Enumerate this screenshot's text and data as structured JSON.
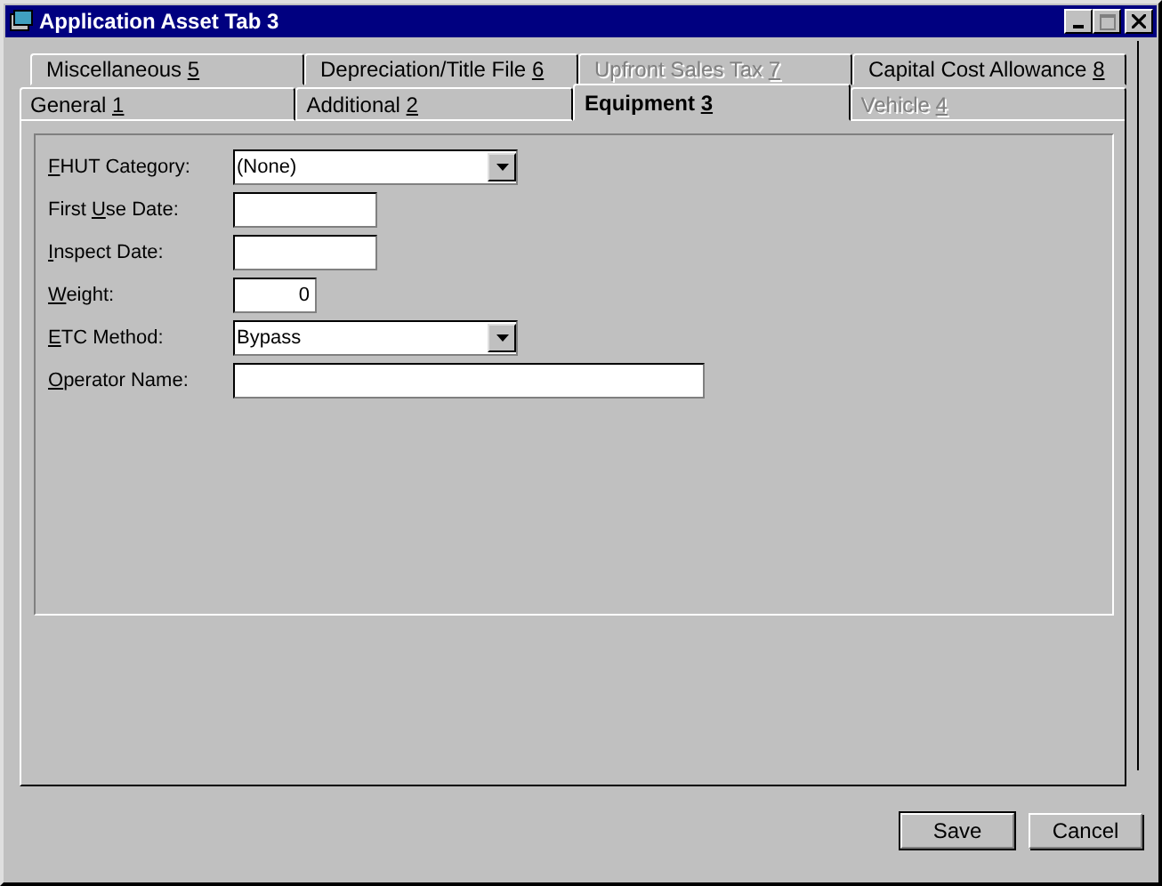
{
  "window": {
    "title": "Application Asset Tab 3"
  },
  "tab_rows": [
    {
      "tabs": [
        {
          "label": "Miscellaneous",
          "key": "5",
          "selected": false,
          "disabled": false
        },
        {
          "label": "Depreciation/Title File",
          "key": "6",
          "selected": false,
          "disabled": false
        },
        {
          "label": "Upfront Sales Tax",
          "key": "7",
          "selected": false,
          "disabled": true
        },
        {
          "label": "Capital Cost Allowance",
          "key": "8",
          "selected": false,
          "disabled": false
        }
      ]
    },
    {
      "tabs": [
        {
          "label": "General",
          "key": "1",
          "selected": false,
          "disabled": false
        },
        {
          "label": "Additional",
          "key": "2",
          "selected": false,
          "disabled": false
        },
        {
          "label": "Equipment",
          "key": "3",
          "selected": true,
          "disabled": false
        },
        {
          "label": "Vehicle",
          "key": "4",
          "selected": false,
          "disabled": true
        }
      ]
    }
  ],
  "fields": [
    {
      "label": {
        "accel": "F",
        "after": "HUT Category:"
      },
      "kind": "dropdown",
      "value": "(None)"
    },
    {
      "label": {
        "before": "First ",
        "accel": "U",
        "after": "se Date:"
      },
      "kind": "date"
    },
    {
      "label": {
        "accel": "I",
        "after": "nspect Date:"
      },
      "kind": "date"
    },
    {
      "label": {
        "accel": "W",
        "after": "eight:"
      },
      "kind": "number",
      "value": "0"
    },
    {
      "label": {
        "accel": "E",
        "after": "TC Method:"
      },
      "kind": "dropdown",
      "value": "Bypass"
    },
    {
      "label": {
        "accel": "O",
        "after": "perator Name:"
      },
      "kind": "text"
    }
  ],
  "buttons": [
    {
      "label": "Save",
      "default": true
    },
    {
      "label": "Cancel",
      "default": false
    }
  ]
}
